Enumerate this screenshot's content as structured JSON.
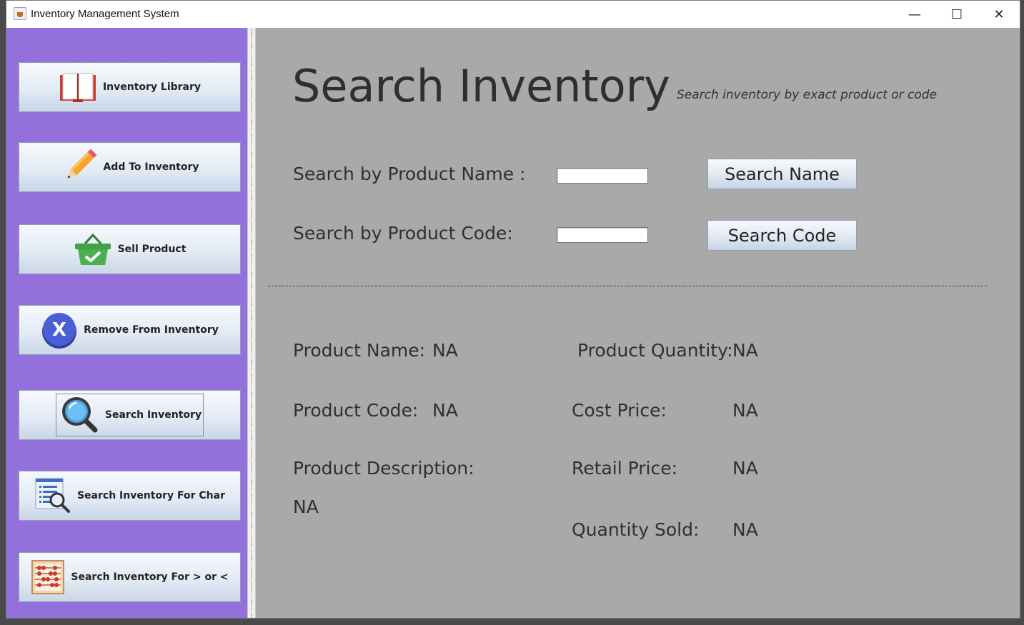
{
  "window": {
    "title": "Inventory Management System"
  },
  "controls": {
    "minimize": "—",
    "maximize": "☐",
    "close": "✕"
  },
  "sidebar": {
    "items": [
      {
        "label": "Inventory Library",
        "icon": "book-icon"
      },
      {
        "label": "Add To Inventory",
        "icon": "pencil-icon"
      },
      {
        "label": "Sell Product",
        "icon": "basket-check-icon"
      },
      {
        "label": "Remove From Inventory",
        "icon": "remove-x-icon"
      },
      {
        "label": "Search Inventory",
        "icon": "magnifier-icon"
      },
      {
        "label": "Search Inventory For Char",
        "icon": "list-search-icon"
      },
      {
        "label": "Search Inventory For > or <",
        "icon": "abacus-icon"
      }
    ]
  },
  "main": {
    "title": "Search Inventory",
    "subtitle": "Search inventory by exact product or code",
    "search": {
      "name_label": "Search by Product Name :",
      "name_value": "",
      "name_button": "Search Name",
      "code_label": "Search by Product Code:",
      "code_value": "",
      "code_button": "Search Code"
    },
    "details": {
      "product_name_label": "Product Name:",
      "product_name": "NA",
      "product_code_label": "Product Code:",
      "product_code": "NA",
      "product_description_label": "Product Description:",
      "product_description": "NA",
      "product_quantity_label": "Product Quantity:",
      "product_quantity": "NA",
      "cost_price_label": "Cost Price:",
      "cost_price": "NA",
      "retail_price_label": "Retail Price:",
      "retail_price": "NA",
      "quantity_sold_label": "Quantity Sold:",
      "quantity_sold": "NA"
    }
  },
  "colors": {
    "sidebar": "#9370db",
    "main_bg": "#a9a9a9",
    "text": "#303030"
  }
}
